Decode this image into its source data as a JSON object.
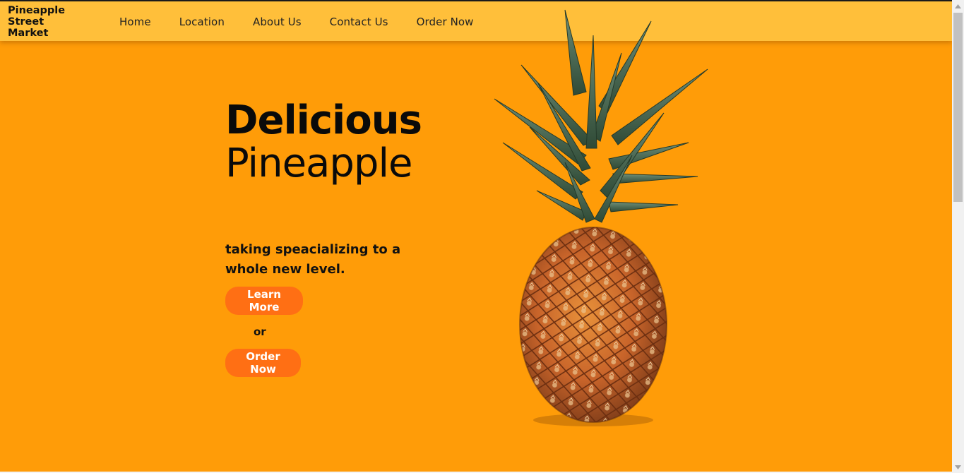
{
  "navbar": {
    "brand": "Pineapple Street Market",
    "links": [
      {
        "label": "Home"
      },
      {
        "label": "Location"
      },
      {
        "label": "About Us"
      },
      {
        "label": "Contact Us"
      },
      {
        "label": "Order Now"
      }
    ]
  },
  "hero": {
    "title": "Delicious",
    "subtitle": "Pineapple",
    "tagline": "taking speacializing to a whole new level.",
    "learn_more_label": "Learn More",
    "or_label": "or",
    "order_now_label": "Order Now",
    "image_name": "pineapple-image"
  },
  "colors": {
    "page_background": "#ff9c08",
    "navbar_background": "#ffbf3a",
    "button_background": "#ff6f14",
    "button_text": "#ffffff"
  }
}
